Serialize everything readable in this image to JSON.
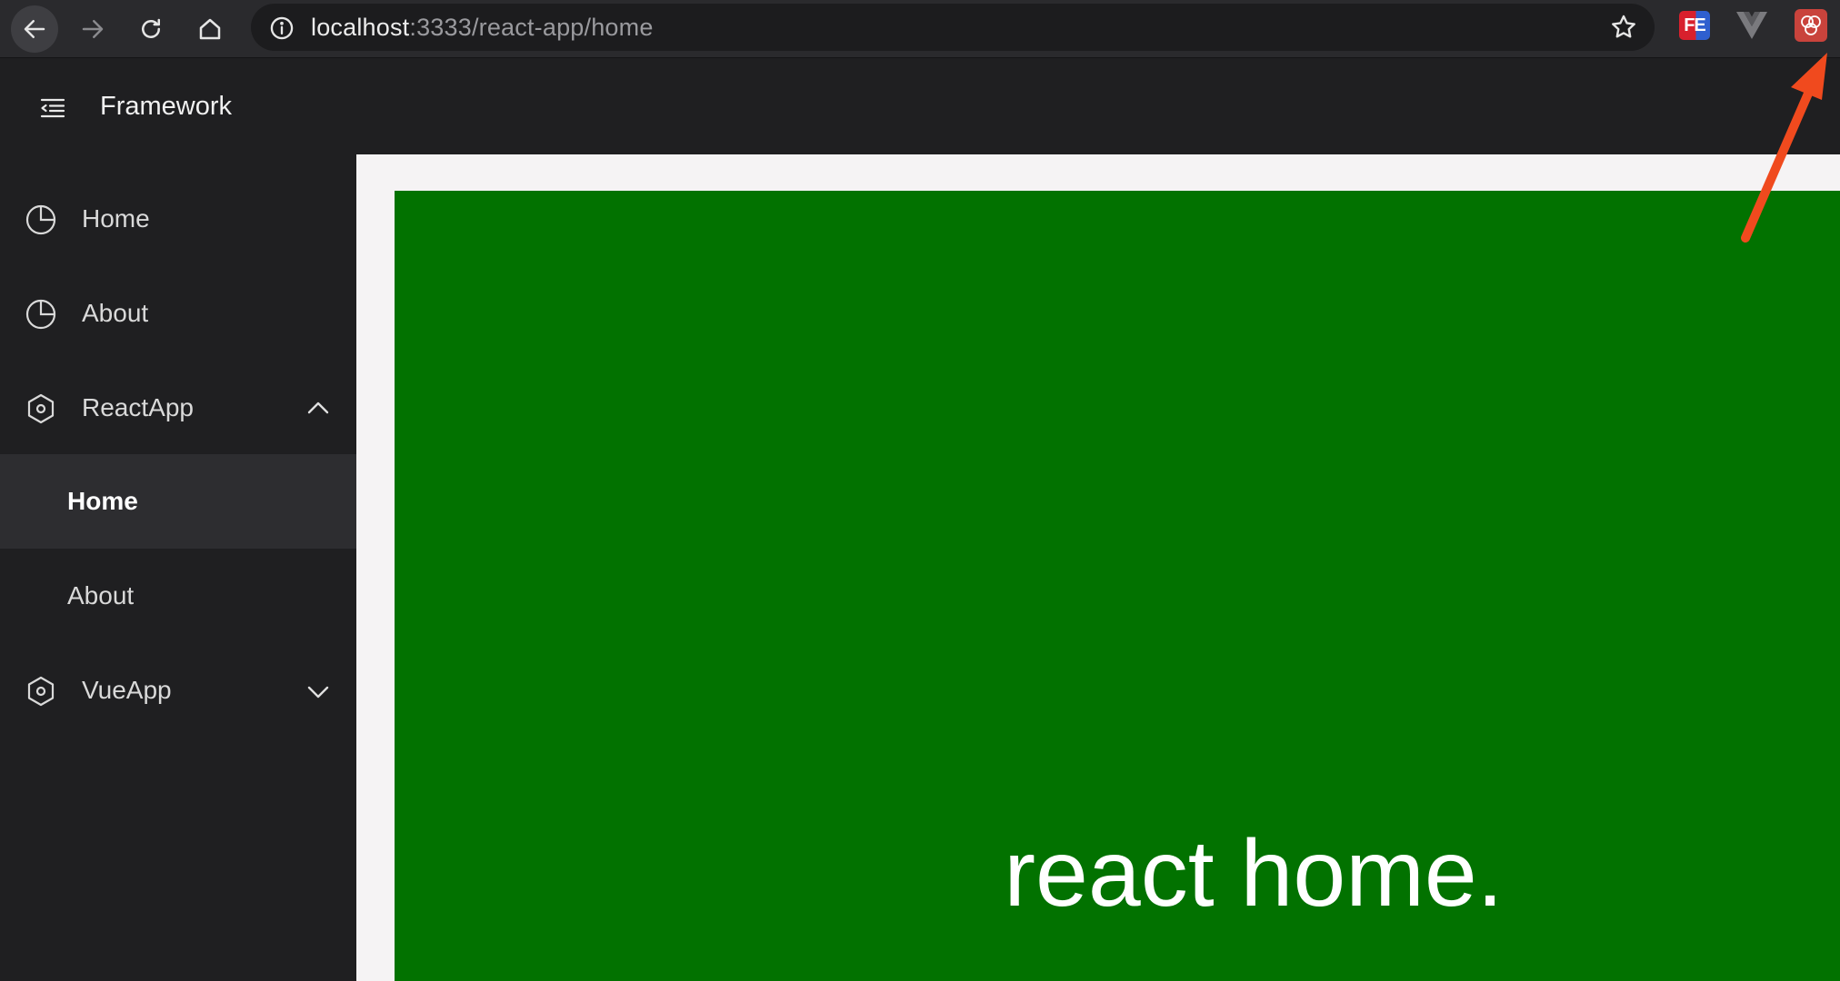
{
  "browser": {
    "url_host": "localhost",
    "url_path": ":3333/react-app/home",
    "icons": {
      "back": "back-arrow-icon",
      "forward": "forward-arrow-icon",
      "reload": "reload-icon",
      "home": "home-icon",
      "site_info": "info-icon",
      "bookmark": "star-icon"
    },
    "extensions": [
      {
        "name": "fe-helper-extension",
        "label": "FE"
      },
      {
        "name": "vue-devtools-extension",
        "label": ""
      },
      {
        "name": "single-spa-extension",
        "label": ""
      }
    ]
  },
  "header": {
    "title": "Framework",
    "menu_icon": "menu-fold-icon"
  },
  "sidebar": {
    "items": [
      {
        "label": "Home",
        "icon": "pie-chart-icon"
      },
      {
        "label": "About",
        "icon": "pie-chart-icon"
      },
      {
        "label": "ReactApp",
        "icon": "hexagon-icon",
        "expanded": true,
        "chevron": "chevron-up-icon",
        "children": [
          {
            "label": "Home",
            "active": true
          },
          {
            "label": "About",
            "active": false
          }
        ]
      },
      {
        "label": "VueApp",
        "icon": "hexagon-icon",
        "expanded": false,
        "chevron": "chevron-down-icon"
      }
    ]
  },
  "main": {
    "heading": "react home."
  },
  "colors": {
    "sidebar_bg": "#1f1f21",
    "active_item_bg": "#2d2d30",
    "content_bg": "#f5f3f4",
    "panel_green": "#027200",
    "annotation_arrow": "#f04a1e"
  }
}
